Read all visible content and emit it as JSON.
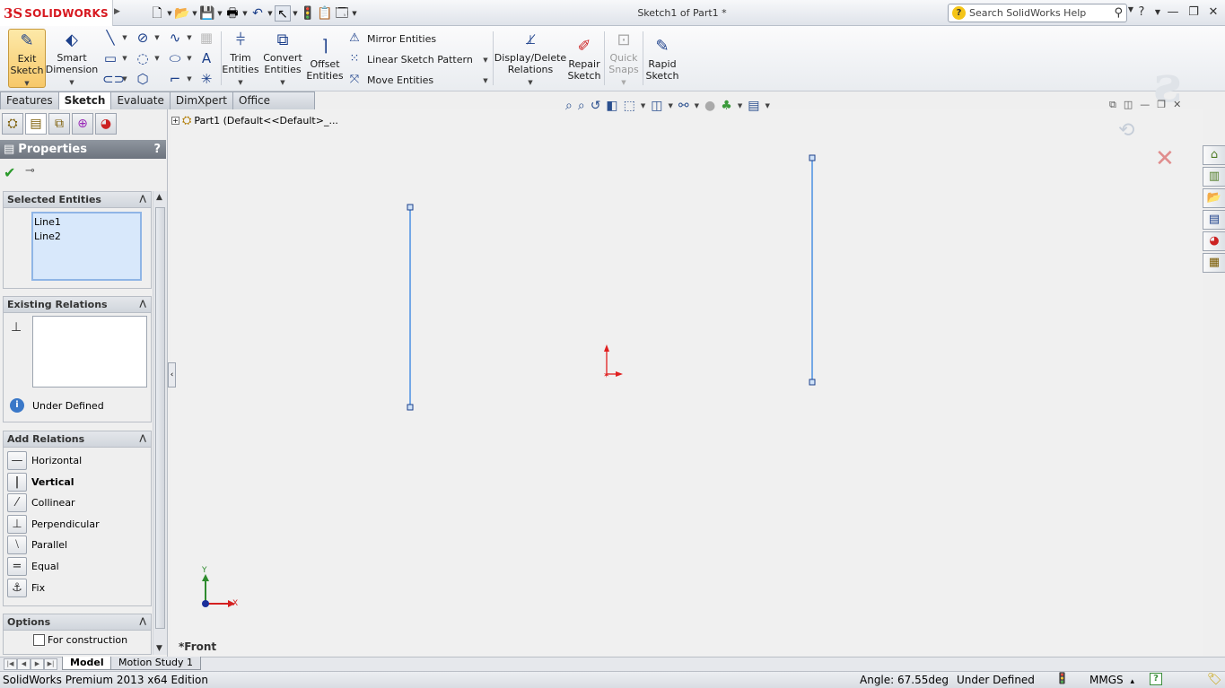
{
  "app": {
    "logo_ds": "3S",
    "logo_name": "SOLIDWORKS",
    "document_title": "Sketch1 of Part1 *",
    "search_placeholder": "Search SolidWorks Help"
  },
  "quick_access": [
    {
      "name": "new-document-icon",
      "glyph": "🗋"
    },
    {
      "name": "open-folder-icon",
      "glyph": "📂"
    },
    {
      "name": "save-icon",
      "glyph": "💾"
    },
    {
      "name": "print-icon",
      "glyph": "🖶"
    },
    {
      "name": "undo-icon",
      "glyph": "↶"
    },
    {
      "name": "select-arrow-icon",
      "glyph": "↖"
    },
    {
      "name": "rebuild-icon",
      "glyph": "🚦"
    },
    {
      "name": "file-properties-icon",
      "glyph": "📋"
    },
    {
      "name": "options-icon",
      "glyph": "🗔"
    }
  ],
  "ribbon": {
    "exit_sketch": "Exit\nSketch",
    "smart_dimension": "Smart\nDimension",
    "trim_entities": "Trim\nEntities",
    "convert_entities": "Convert\nEntities",
    "offset_entities": "Offset\nEntities",
    "mirror_entities": "Mirror Entities",
    "linear_sketch_pattern": "Linear Sketch Pattern",
    "move_entities": "Move Entities",
    "display_delete_relations": "Display/Delete\nRelations",
    "repair_sketch": "Repair\nSketch",
    "quick_snaps": "Quick\nSnaps",
    "rapid_sketch": "Rapid\nSketch"
  },
  "tabs": [
    "Features",
    "Sketch",
    "Evaluate",
    "DimXpert",
    "Office Products"
  ],
  "active_tab": "Sketch",
  "panel": {
    "title": "Properties",
    "help": "?",
    "selected_entities": {
      "header": "Selected Entities",
      "items": [
        "Line1",
        "Line2"
      ]
    },
    "existing_relations": {
      "header": "Existing Relations",
      "status": "Under Defined"
    },
    "add_relations": {
      "header": "Add Relations",
      "items": [
        {
          "label": "Horizontal",
          "glyph": "—"
        },
        {
          "label": "Vertical",
          "glyph": "|"
        },
        {
          "label": "Collinear",
          "glyph": "⁄"
        },
        {
          "label": "Perpendicular",
          "glyph": "⊥"
        },
        {
          "label": "Parallel",
          "glyph": "⧵"
        },
        {
          "label": "Equal",
          "glyph": "="
        },
        {
          "label": "Fix",
          "glyph": "⚓"
        }
      ]
    },
    "options": {
      "header": "Options",
      "for_construction": "For construction",
      "for_construction_checked": false
    }
  },
  "graphics": {
    "tree_root": "Part1  (Default<<Default>_...",
    "view_name": "*Front",
    "triad_x": "X",
    "triad_y": "Y"
  },
  "bottom_tabs": [
    "Model",
    "Motion Study 1"
  ],
  "status": {
    "app": "SolidWorks Premium 2013 x64 Edition",
    "angle": "Angle: 67.55deg",
    "definition": "Under Defined",
    "units": "MMGS",
    "units_arrow": "▴"
  },
  "colors": {
    "sketch_line": "#4a90e2",
    "origin": "#e02020",
    "accent": "#f7c86a"
  }
}
